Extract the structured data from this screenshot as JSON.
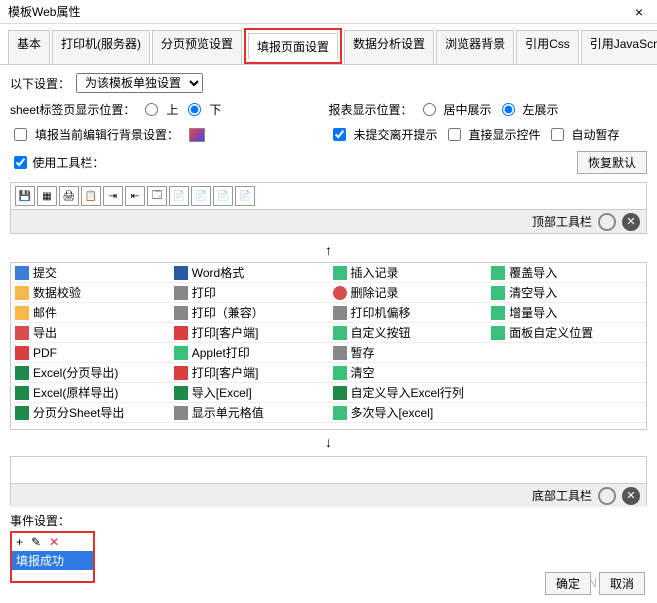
{
  "window": {
    "title": "模板Web属性",
    "close": "×"
  },
  "tabs": [
    "基本",
    "打印机(服务器)",
    "分页预览设置",
    "填报页面设置",
    "数据分析设置",
    "浏览器背景",
    "引用Css",
    "引用JavaScript"
  ],
  "activeTab": 3,
  "settings": {
    "belowLabel": "以下设置：",
    "modeSelected": "为该模板单独设置",
    "sheetPosLabel": "sheet标签页显示位置：",
    "sheetUp": "上",
    "sheetDown": "下",
    "reportPosLabel": "报表显示位置：",
    "centerShow": "居中展示",
    "leftShow": "左展示",
    "bgSetting": "填报当前编辑行背景设置：",
    "unsubmitPrompt": "未提交离开提示",
    "directShow": "直接显示控件",
    "autoPause": "自动暂存",
    "useToolbar": "使用工具栏：",
    "restoreDefault": "恢复默认",
    "topToolbar": "顶部工具栏",
    "bottomToolbar": "底部工具栏"
  },
  "iconRow": [
    "💾",
    "▦",
    "🖨",
    "📋",
    "⇥",
    "⇤",
    "🗔",
    "📄",
    "📄",
    "📄",
    "📄"
  ],
  "gridItems": [
    {
      "icon": "gi-save",
      "text": "提交"
    },
    {
      "icon": "gi-word",
      "text": "Word格式"
    },
    {
      "icon": "gi-ins",
      "text": "插入记录"
    },
    {
      "icon": "gi-cov",
      "text": "覆盖导入"
    },
    {
      "icon": "gi-check",
      "text": "数据校验"
    },
    {
      "icon": "gi-print",
      "text": "打印"
    },
    {
      "icon": "gi-del",
      "text": "删除记录"
    },
    {
      "icon": "gi-imp",
      "text": "清空导入"
    },
    {
      "icon": "gi-mail",
      "text": "邮件"
    },
    {
      "icon": "gi-print",
      "text": "打印（兼容）"
    },
    {
      "icon": "gi-print",
      "text": "打印机偏移"
    },
    {
      "icon": "gi-imp",
      "text": "增量导入"
    },
    {
      "icon": "gi-export",
      "text": "导出"
    },
    {
      "icon": "gi-pdf",
      "text": "打印[客户端]"
    },
    {
      "icon": "gi-add",
      "text": "自定义按钮"
    },
    {
      "icon": "gi-add",
      "text": "面板自定义位置"
    },
    {
      "icon": "gi-pdf",
      "text": "PDF"
    },
    {
      "icon": "gi-applet",
      "text": "Applet打印"
    },
    {
      "icon": "gi-show",
      "text": "暂存"
    },
    {
      "icon": "",
      "text": ""
    },
    {
      "icon": "gi-excel",
      "text": "Excel(分页导出)"
    },
    {
      "icon": "gi-pdf",
      "text": "打印[客户端]"
    },
    {
      "icon": "gi-add",
      "text": "清空"
    },
    {
      "icon": "",
      "text": ""
    },
    {
      "icon": "gi-excel",
      "text": "Excel(原样导出)"
    },
    {
      "icon": "gi-excel",
      "text": "导入[Excel]"
    },
    {
      "icon": "gi-excel",
      "text": "自定义导入Excel行列"
    },
    {
      "icon": "",
      "text": ""
    },
    {
      "icon": "gi-excel",
      "text": "分页分Sheet导出"
    },
    {
      "icon": "gi-show",
      "text": "显示单元格值"
    },
    {
      "icon": "gi-multi",
      "text": "多次导入[excel]"
    },
    {
      "icon": "",
      "text": ""
    }
  ],
  "events": {
    "label": "事件设置：",
    "add": "+",
    "edit": "✎",
    "del": "✕",
    "selected": "填报成功"
  },
  "buttons": {
    "ok": "确定",
    "cancel": "取消"
  },
  "watermark": "CSDN @专"
}
